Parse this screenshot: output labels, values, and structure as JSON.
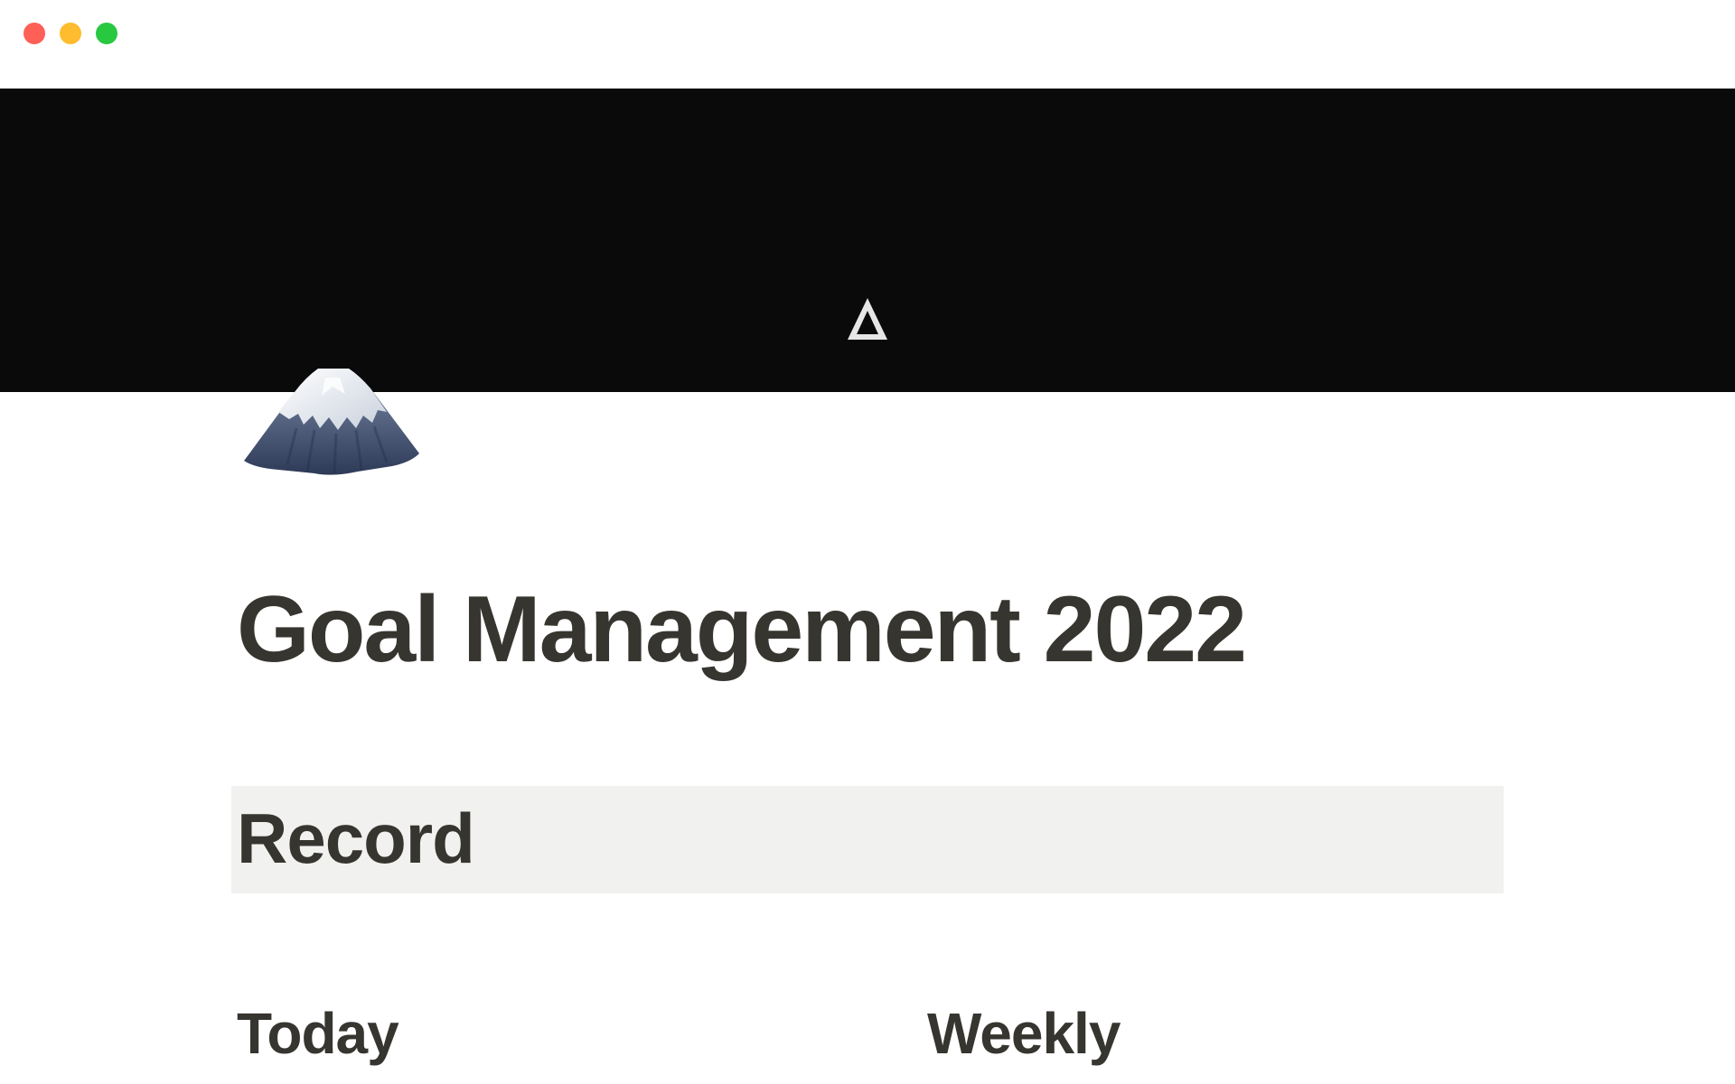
{
  "window": {
    "controls": {
      "close": "close",
      "minimize": "minimize",
      "maximize": "maximize"
    }
  },
  "cover": {
    "background_color": "#0a0a0a",
    "logo_icon": "delta-logo-icon"
  },
  "page": {
    "icon": "mountain-fuji-icon",
    "title": "Goal Management 2022"
  },
  "sections": {
    "record_heading": "Record",
    "columns": {
      "today": "Today",
      "weekly": "Weekly"
    }
  },
  "colors": {
    "text": "#37352f",
    "callout_bg": "#f1f1ef",
    "close": "#fe5f57",
    "minimize": "#febc2e",
    "maximize": "#28c840"
  }
}
